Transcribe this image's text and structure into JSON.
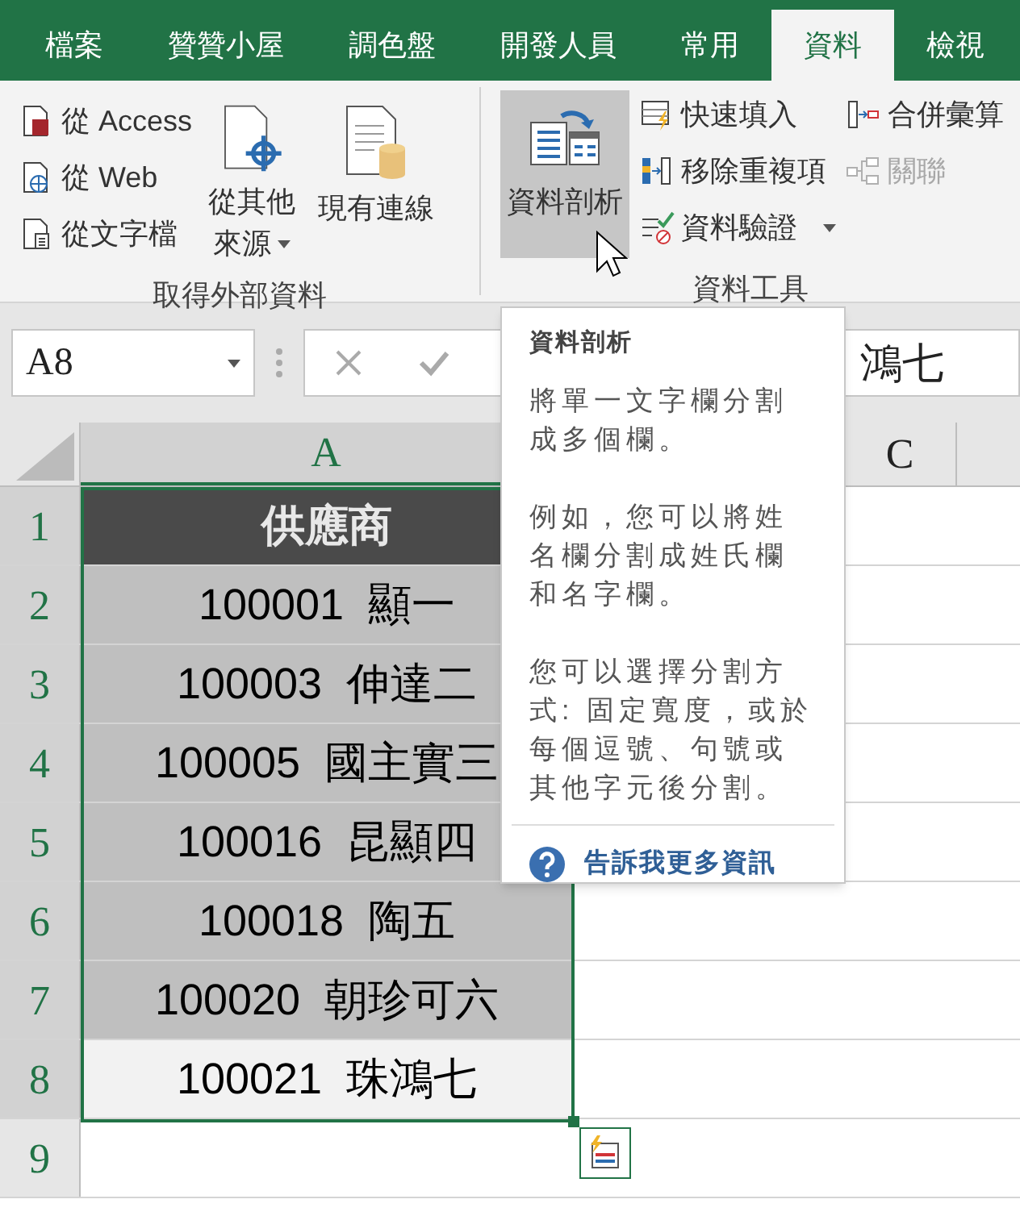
{
  "tabs": [
    {
      "label": "檔案",
      "selected": false
    },
    {
      "label": "贊贊小屋",
      "selected": false
    },
    {
      "label": "調色盤",
      "selected": false
    },
    {
      "label": "開發人員",
      "selected": false
    },
    {
      "label": "常用",
      "selected": false
    },
    {
      "label": "資料",
      "selected": true
    },
    {
      "label": "檢視",
      "selected": false
    }
  ],
  "ribbon": {
    "groups": [
      {
        "label": "取得外部資料",
        "columns": [
          {
            "kind": "small",
            "items": [
              {
                "label": "從 Access",
                "disabled": false
              },
              {
                "label": "從 Web",
                "disabled": false
              },
              {
                "label": "從文字檔",
                "disabled": false
              }
            ]
          },
          {
            "kind": "large",
            "items": [
              {
                "label": "從其他",
                "label2": "來源",
                "dropdown": true,
                "highlighted": false
              }
            ]
          },
          {
            "kind": "large",
            "items": [
              {
                "label": "現有連線",
                "highlighted": false
              }
            ]
          }
        ]
      },
      {
        "label": "資料工具",
        "columns": [
          {
            "kind": "large",
            "items": [
              {
                "label": "資料剖析",
                "highlighted": true
              }
            ]
          },
          {
            "kind": "small",
            "items": [
              {
                "label": "快速填入",
                "disabled": false
              },
              {
                "label": "移除重複項",
                "disabled": false
              },
              {
                "label": "資料驗證",
                "disabled": false,
                "dropdown": true
              }
            ]
          },
          {
            "kind": "small",
            "items": [
              {
                "label": "合併彙算",
                "disabled": false
              },
              {
                "label": "關聯",
                "disabled": true
              }
            ]
          }
        ]
      }
    ]
  },
  "name_box": "A8",
  "formula": "鴻七",
  "columns": [
    "A",
    "C"
  ],
  "rows": [
    {
      "number": "1",
      "cell": "供應商",
      "kind": "header"
    },
    {
      "number": "2",
      "cell": "100001  顯一",
      "kind": "data",
      "active": false
    },
    {
      "number": "3",
      "cell": "100003  伸達二",
      "kind": "data",
      "active": false
    },
    {
      "number": "4",
      "cell": "100005  國主實三",
      "kind": "data",
      "active": false
    },
    {
      "number": "5",
      "cell": "100016  昆顯四",
      "kind": "data",
      "active": false
    },
    {
      "number": "6",
      "cell": "100018  陶五",
      "kind": "data",
      "active": false
    },
    {
      "number": "7",
      "cell": "100020  朝珍可六",
      "kind": "data",
      "active": false
    },
    {
      "number": "8",
      "cell": "100021  珠鴻七",
      "kind": "data",
      "active": true
    },
    {
      "number": "9",
      "kind": "empty"
    }
  ],
  "tooltip": {
    "title": "資料剖析",
    "paragraphs": [
      "將單一文字欄分割成多個欄。",
      "例如，您可以將姓名欄分割成姓氏欄和名字欄。",
      "您可以選擇分割方式: 固定寬度，或於每個逗號、句號或其他字元後分割。"
    ],
    "link": "告訴我更多資訊"
  }
}
